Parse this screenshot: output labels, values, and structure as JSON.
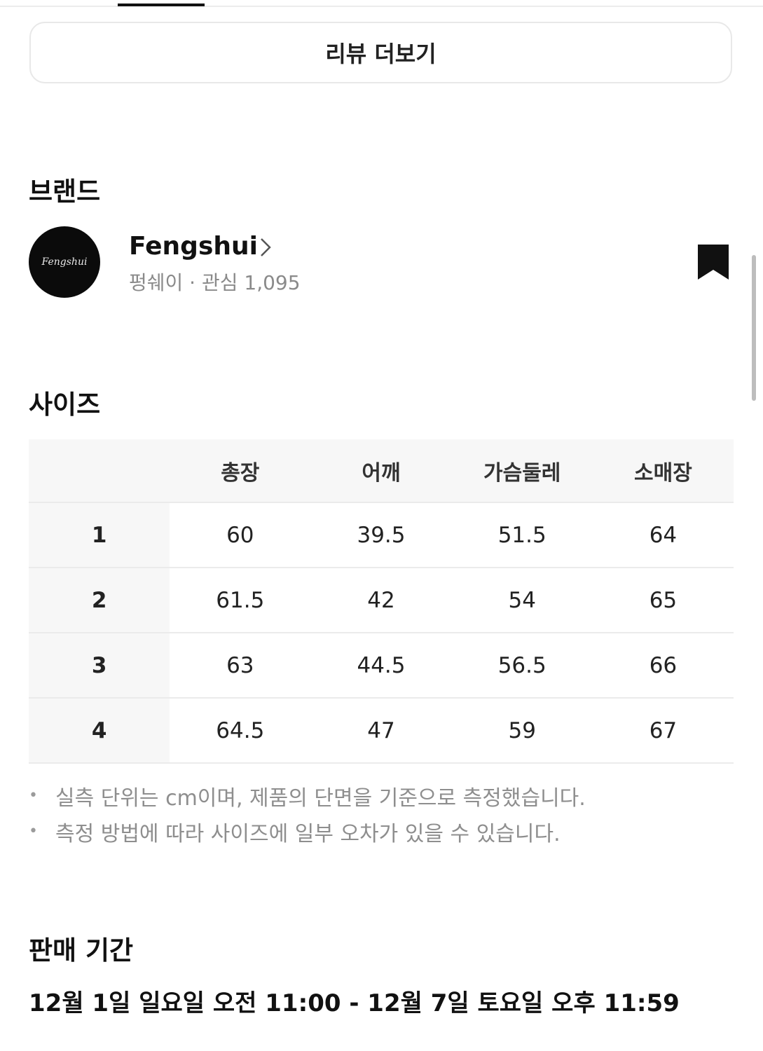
{
  "review": {
    "more_label": "리뷰 더보기"
  },
  "brand": {
    "section_title": "브랜드",
    "logo_text": "Fengshui",
    "name": "Fengshui",
    "meta": "펑쉐이 · 관심 1,095"
  },
  "size": {
    "section_title": "사이즈",
    "columns": [
      "",
      "총장",
      "어깨",
      "가슴둘레",
      "소매장"
    ],
    "rows": [
      [
        "1",
        "60",
        "39.5",
        "51.5",
        "64"
      ],
      [
        "2",
        "61.5",
        "42",
        "54",
        "65"
      ],
      [
        "3",
        "63",
        "44.5",
        "56.5",
        "66"
      ],
      [
        "4",
        "64.5",
        "47",
        "59",
        "67"
      ]
    ],
    "notes": [
      "실측 단위는 cm이며, 제품의 단면을 기준으로 측정했습니다.",
      "측정 방법에 따라 사이즈에 일부 오차가 있을 수 있습니다."
    ]
  },
  "sale_period": {
    "section_title": "판매 기간",
    "text": "12월 1일 일요일 오전 11:00 - 12월 7일 토요일 오후 11:59"
  }
}
